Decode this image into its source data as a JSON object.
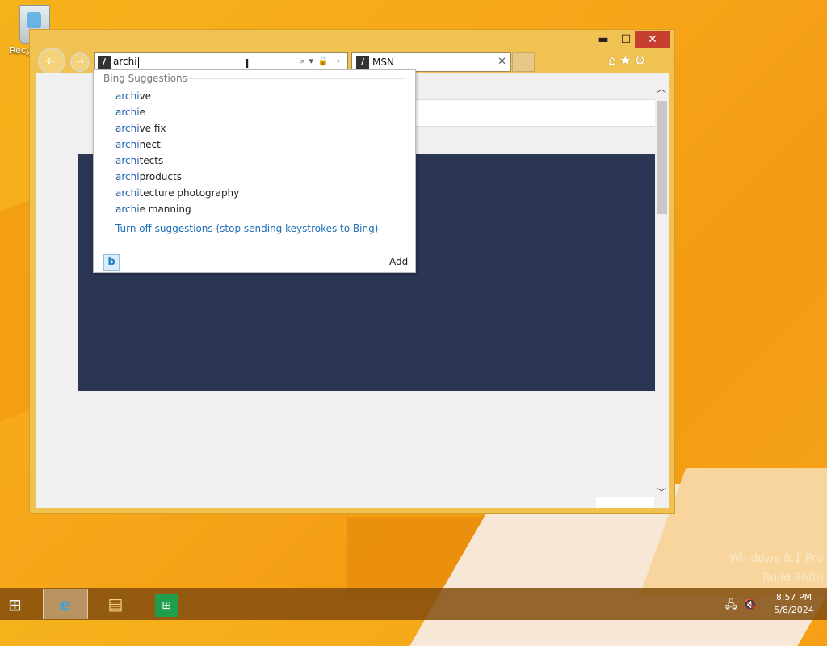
{
  "desktop": {
    "recycle_bin_label": "Recy",
    "watermark_line1": "Windows 8.1 Pro",
    "watermark_line2": "Build 9600"
  },
  "window": {
    "controls": {
      "minimize": "▬",
      "maximize": "☐",
      "close": "✕"
    },
    "nav": {
      "back": "←",
      "forward": "→"
    },
    "address_bar": {
      "value": "archi",
      "icons": "⌕▾🔒→"
    },
    "tab": {
      "title": "MSN",
      "close": "✕"
    },
    "toolbar_icons": "⌂★⚙"
  },
  "suggestions": {
    "header": "Bing Suggestions",
    "items": [
      {
        "match": "archi",
        "rest": "ve"
      },
      {
        "match": "archi",
        "rest": "e"
      },
      {
        "match": "archi",
        "rest": "ve fix"
      },
      {
        "match": "archi",
        "rest": "nect"
      },
      {
        "match": "archi",
        "rest": "tects"
      },
      {
        "match": "archi",
        "rest": "products"
      },
      {
        "match": "archi",
        "rest": "tecture photography"
      },
      {
        "match": "archi",
        "rest": "e manning"
      }
    ],
    "turn_off": "Turn off suggestions (stop sending keystrokes to Bing)",
    "provider_glyph": "b",
    "add_label": "Add"
  },
  "scrollbar": {
    "up": "︿",
    "down": "﹀"
  },
  "taskbar": {
    "start_glyph": "⊞",
    "ie_glyph": "e",
    "explorer_glyph": "▤",
    "store_glyph": "⊞",
    "tray_icons": "🖧🔇",
    "time": "8:57 PM",
    "date": "5/8/2024"
  },
  "colors": {
    "desktop_bg": "#f5b21b",
    "window_frame": "#f0c252",
    "close_button": "#c7402f",
    "page_panel": "#2b3654",
    "link_blue": "#1f6fb8"
  }
}
